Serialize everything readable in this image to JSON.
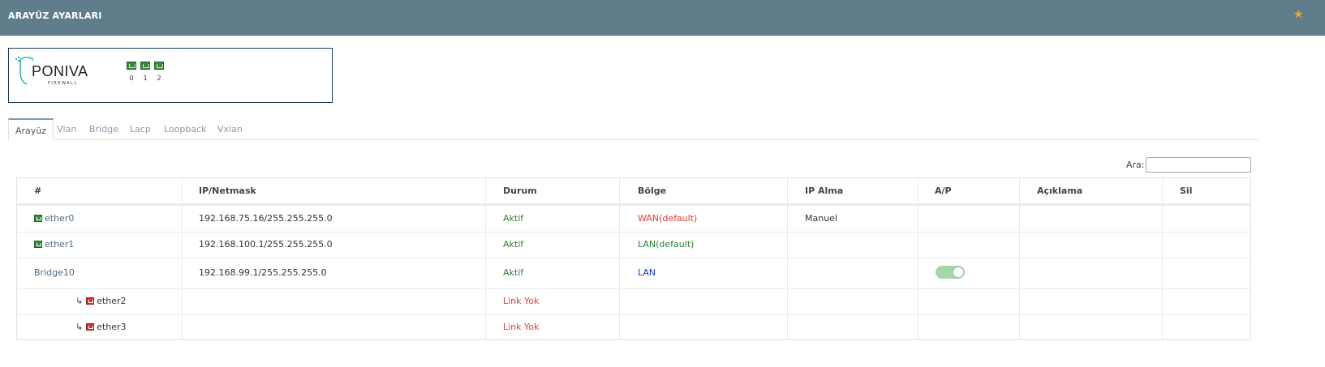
{
  "header": {
    "title": "ARAYÜZ AYARLARI",
    "icon": "star-icon",
    "icon_color": "#f5a623",
    "bar_color": "#607d8b"
  },
  "device": {
    "logo": {
      "brand": "PONIVA",
      "sub": "FIREWALL"
    },
    "ports": [
      "0",
      "1",
      "2"
    ]
  },
  "tabs": [
    "Arayüz",
    "Vlan",
    "Bridge",
    "Lacp",
    "Loopback",
    "Vxlan"
  ],
  "active_tab": "Arayüz",
  "search": {
    "label": "Ara:",
    "value": ""
  },
  "table": {
    "headers": [
      "#",
      "IP/Netmask",
      "Durum",
      "Bölge",
      "IP Alma",
      "A/P",
      "Açıklama",
      "Sil"
    ],
    "rows": [
      {
        "name": "ether0",
        "ip": "192.168.75.16/255.255.255.0",
        "status": "Aktif",
        "zone": "WAN(default)",
        "ip_mode": "Manuel"
      },
      {
        "name": "ether1",
        "ip": "192.168.100.1/255.255.255.0",
        "status": "Aktif",
        "zone": "LAN(default)",
        "ip_mode": ""
      },
      {
        "name": "Bridge10",
        "ip": "192.168.99.1/255.255.255.0",
        "status": "Aktif",
        "zone": "LAN",
        "ip_mode": "",
        "ap_toggle": true
      },
      {
        "name": "ether2",
        "arrow": "↳",
        "ip": "",
        "status": "Link Yok",
        "zone": "",
        "ip_mode": ""
      },
      {
        "name": "ether3",
        "arrow": "↳",
        "ip": "",
        "status": "Link Yok",
        "zone": "",
        "ip_mode": ""
      }
    ]
  },
  "colors": {
    "active": "#2e7d32",
    "link_down": "#e53935",
    "wan": "#e53935",
    "lan_default": "#2e7d32",
    "lan": "#1a35c9",
    "toggle_on": "#a5d6a7"
  }
}
